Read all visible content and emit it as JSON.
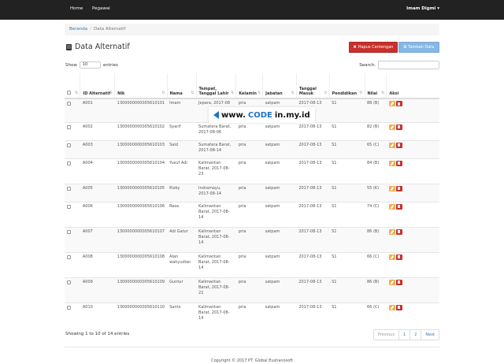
{
  "nav": {
    "home": "Home",
    "pegawai": "Pegawai",
    "user": "Imam Digmi",
    "caret": "▾"
  },
  "breadcrumb": {
    "home": "Beranda",
    "sep": "/",
    "current": "Data Alternatif"
  },
  "page": {
    "title": "Data Alternatif"
  },
  "buttons": {
    "hapus": "Hapus Centengan",
    "tambah": "Tambah Data",
    "hapus_icon": "✖",
    "tambah_icon": "⧉"
  },
  "length": {
    "show": "Show",
    "value": "10",
    "entries": "entries"
  },
  "search": {
    "label": "Search:"
  },
  "table": {
    "headers": [
      "",
      "ID Alternatif",
      "Nik",
      "Nama",
      "Tempat, Tanggal Lahir",
      "Kelamin",
      "Jabatan",
      "Tanggal Masuk",
      "Pendidikan",
      "Nilai",
      "Aksi"
    ],
    "sort_glyph": "⇅",
    "rows": [
      {
        "id": "A001",
        "nik": "1300000000005610101",
        "nama": "Imam",
        "ttl": "Jepara, 2017-08",
        "kelamin": "pria",
        "jabatan": "satpam",
        "masuk": "2017-08-13",
        "pendidikan": "S1",
        "nilai": "88 (B)"
      },
      {
        "id": "A002",
        "nik": "1300000000005610102",
        "nama": "Syarif",
        "ttl": "Sumatera Barat, 2017-08-06",
        "kelamin": "pria",
        "jabatan": "satpam",
        "masuk": "2017-08-13",
        "pendidikan": "S1",
        "nilai": "82 (B)"
      },
      {
        "id": "A003",
        "nik": "1300000000005610103",
        "nama": "Said",
        "ttl": "Sumatera Barat, 2017-08-14",
        "kelamin": "pria",
        "jabatan": "satpam",
        "masuk": "2017-08-13",
        "pendidikan": "S1",
        "nilai": "65 (C)"
      },
      {
        "id": "A004",
        "nik": "1300000000005610104",
        "nama": "Yusuf Adi",
        "ttl": "Kalimantan Barat, 2017-08-23",
        "kelamin": "pria",
        "jabatan": "satpam",
        "masuk": "2017-08-13",
        "pendidikan": "S1",
        "nilai": "84 (B)"
      },
      {
        "id": "A005",
        "nik": "1300000000005610105",
        "nama": "Rizky",
        "ttl": "Indramayu, 2017-08-14",
        "kelamin": "pria",
        "jabatan": "satpam",
        "masuk": "2017-08-13",
        "pendidikan": "S1",
        "nilai": "55 (K)"
      },
      {
        "id": "A006",
        "nik": "1300000000005610106",
        "nama": "Reza",
        "ttl": "Kalimantan Barat, 2017-08-14",
        "kelamin": "pria",
        "jabatan": "satpam",
        "masuk": "2017-08-13",
        "pendidikan": "S1",
        "nilai": "74 (C)"
      },
      {
        "id": "A007",
        "nik": "1300000000005610107",
        "nama": "Adi Gatur",
        "ttl": "Kalimantan Barat, 2017-08-14",
        "kelamin": "pria",
        "jabatan": "satpam",
        "masuk": "2017-08-13",
        "pendidikan": "S1",
        "nilai": "86 (B)"
      },
      {
        "id": "A008",
        "nik": "1300000000005610108",
        "nama": "Alan wahyudian",
        "ttl": "Kalimantan Barat, 2017-08-14",
        "kelamin": "pria",
        "jabatan": "satpam",
        "masuk": "2017-08-13",
        "pendidikan": "S1",
        "nilai": "66 (C)"
      },
      {
        "id": "A009",
        "nik": "1300000000005610109",
        "nama": "Guntur",
        "ttl": "Kalimantan Barat, 2017-08-21",
        "kelamin": "pria",
        "jabatan": "satpam",
        "masuk": "2017-08-13",
        "pendidikan": "S1",
        "nilai": "86 (B)"
      },
      {
        "id": "A010",
        "nik": "1300000000005610110",
        "nama": "Santo",
        "ttl": "Kalimantan Barat, 2017-08-14",
        "kelamin": "pria",
        "jabatan": "satpam",
        "masuk": "2017-08-13",
        "pendidikan": "S1",
        "nilai": "66 (C)"
      }
    ]
  },
  "info": "Showing 1 to 10 of 14 entries",
  "pagination": [
    "Previous",
    "1",
    "2",
    "Next"
  ],
  "footer": "Copyright © 2017 PT. Global Eushanosoft",
  "watermark": {
    "prefix": "www.",
    "highlight": "CODE",
    "suffix": "in.my.id"
  },
  "colors": {
    "danger": "#c9302c",
    "primary": "#87b7e4",
    "warning": "#f0ad4e",
    "navbar": "#222222"
  }
}
